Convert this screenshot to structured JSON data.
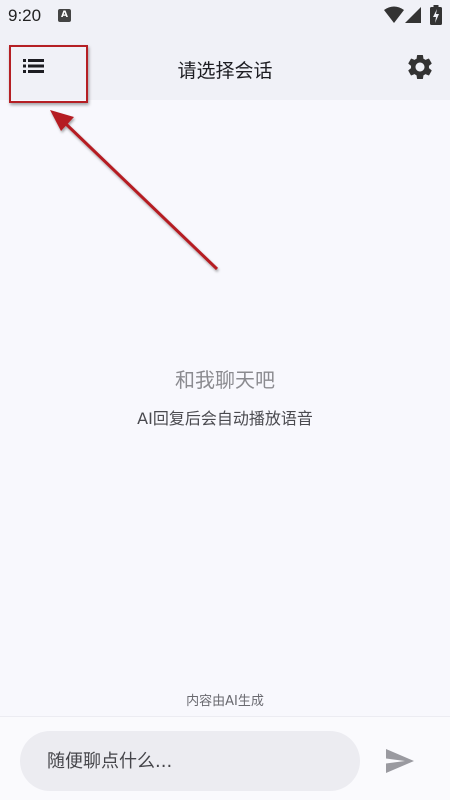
{
  "status_bar": {
    "time": "9:20",
    "notification_glyph": "A",
    "icons": [
      "wifi-icon",
      "signal-icon",
      "battery-charging-icon"
    ]
  },
  "header": {
    "title": "请选择会话",
    "menu_icon": "list-menu-icon",
    "settings_icon": "gear-icon"
  },
  "empty_state": {
    "title": "和我聊天吧",
    "subtitle": "AI回复后会自动播放语音"
  },
  "footer": {
    "ai_note": "内容由AI生成"
  },
  "composer": {
    "placeholder": "随便聊点什么...",
    "value": "",
    "send_icon": "send-icon"
  },
  "colors": {
    "background": "#f8f8fd",
    "header_background": "#f0f1f7",
    "annotation_red": "#b51f24",
    "input_background": "#ececf1"
  }
}
